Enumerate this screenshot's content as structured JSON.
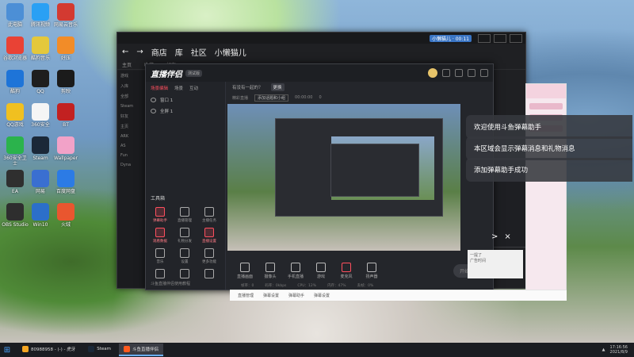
{
  "desktop": {
    "icons": [
      {
        "label": "此电脑",
        "color": "#4c8fd6"
      },
      {
        "label": "腾讯视频",
        "color": "#2aa0f4"
      },
      {
        "label": "网易云音乐",
        "color": "#d33a31"
      },
      {
        "label": "谷歌浏览器",
        "color": "#e94235"
      },
      {
        "label": "酷狗音乐",
        "color": "#e4c83b"
      },
      {
        "label": "好压",
        "color": "#f28c28"
      },
      {
        "label": "酷狗",
        "color": "#1e74d8"
      },
      {
        "label": "QQ",
        "color": "#1e1e1e"
      },
      {
        "label": "剪映",
        "color": "#1b1b1b"
      },
      {
        "label": "QQ游戏",
        "color": "#f0c020"
      },
      {
        "label": "360安全",
        "color": "#f5f5f5"
      },
      {
        "label": "BT",
        "color": "#c22121"
      },
      {
        "label": "360安全卫士",
        "color": "#2bb34c"
      },
      {
        "label": "Steam",
        "color": "#1b2838"
      },
      {
        "label": "Wallpaper",
        "color": "#f2a2c8"
      },
      {
        "label": "EA",
        "color": "#2f2f2f"
      },
      {
        "label": "网易",
        "color": "#3a6fd1"
      },
      {
        "label": "百度网盘",
        "color": "#2c7be5"
      },
      {
        "label": "OBS Studio",
        "color": "#2e2e2e"
      },
      {
        "label": "Win10",
        "color": "#2c6fc9"
      },
      {
        "label": "火绒",
        "color": "#e9562f"
      }
    ]
  },
  "host_window": {
    "title_badge": "小懒猫儿 · 00:11",
    "nav": {
      "back": "←",
      "forward": "→",
      "store": "商店",
      "library": "库",
      "community": "社区",
      "username": "小懒猫儿"
    },
    "tabs": [
      "主页",
      "收藏",
      "好友"
    ],
    "sidebar": [
      "游戏",
      "入库",
      "全部",
      "Steam",
      "好友",
      "主页",
      "ARK",
      "AS",
      "Fun",
      "Dyna"
    ]
  },
  "app": {
    "logo": "直播伴侣",
    "tag": "测试版",
    "scene_tabs": [
      "场景编辑",
      "场景",
      "互动"
    ],
    "scenes": [
      "窗口 1",
      "全屏 1"
    ],
    "topic_label": "有没有一起的？",
    "topic_change": "更换",
    "title_label": "精彩直播",
    "title_placeholder": "添加话题和小组",
    "title_values": [
      "00:00:00",
      "0"
    ],
    "tools_title": "工具箱",
    "tools": [
      {
        "label": "弹幕助手",
        "red": true
      },
      {
        "label": "直播管理",
        "red": false
      },
      {
        "label": "主播任务",
        "red": false
      },
      {
        "label": "观看数据",
        "red": true
      },
      {
        "label": "礼物分发",
        "red": false
      },
      {
        "label": "直播设置",
        "red": true
      },
      {
        "label": "音乐",
        "red": false
      },
      {
        "label": "设置",
        "red": false
      },
      {
        "label": "更多功能",
        "red": false
      },
      {
        "label": "",
        "red": false
      },
      {
        "label": "",
        "red": false
      },
      {
        "label": "",
        "red": false
      }
    ],
    "bottom_note": "斗鱼直播伴侣使用教程",
    "controls": [
      {
        "label": "直播画面",
        "red": false
      },
      {
        "label": "摄像头",
        "red": false
      },
      {
        "label": "手机直播",
        "red": false
      },
      {
        "label": "游戏",
        "red": false
      },
      {
        "label": "麦克风",
        "red": true
      },
      {
        "label": "扬声器",
        "red": false
      }
    ],
    "start_label": "开始直播",
    "stats": [
      "帧率：0",
      "码率：0kbps",
      "CPU：12%",
      "内存：47%",
      "丢帧：0%"
    ]
  },
  "notifications": [
    "欢迎使用斗鱼弹幕助手",
    "本区域会显示弹幕消息和礼物消息",
    "添加弹幕助手成功"
  ],
  "toast_controls": {
    "next": ">",
    "close": "×"
  },
  "danmu_bar": {
    "label": "一提了",
    "sub": "广告时间"
  },
  "bottom_strip": [
    "直播管理",
    "弹幕设置",
    "弹幕助手",
    "弹幕设置"
  ],
  "taskbar": {
    "start": "⊞",
    "tasks": [
      {
        "label": "80988958 - (-) - 虎牙",
        "color": "#f5a623",
        "active": false
      },
      {
        "label": "Steam",
        "color": "#1b2838",
        "active": false
      },
      {
        "label": "斗鱼直播伴侣",
        "color": "#ff5a1f",
        "active": true
      }
    ],
    "time": "17:16:56",
    "date": "2021/8/9"
  }
}
